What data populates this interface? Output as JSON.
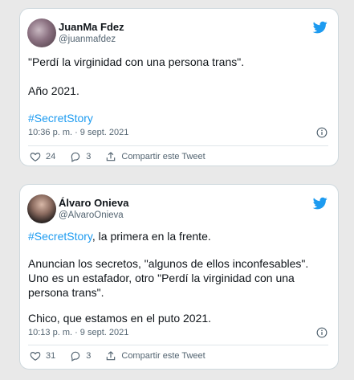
{
  "tweets": [
    {
      "author_name": "JuanMa Fdez",
      "author_handle": "@juanmafdez",
      "line1": "\"Perdí la virginidad con una persona trans\".",
      "line2": "Año 2021.",
      "hashtag": "#SecretStory",
      "timestamp": "10:36 p. m. · 9 sept. 2021",
      "likes": "24",
      "replies": "3",
      "share_label": "Compartir este Tweet"
    },
    {
      "author_name": "Álvaro Onieva",
      "author_handle": "@AlvaroOnieva",
      "hashtag": "#SecretStory",
      "line1_rest": ", la primera en la frente.",
      "para2_l1": "Anuncian los secretos, \"algunos de ellos inconfesables\".",
      "para2_l2": "Uno es un estafador, otro \"Perdí la virginidad con una",
      "para2_l3": "persona trans\".",
      "para3": "Chico, que estamos en el puto 2021.",
      "timestamp": "10:13 p. m. · 9 sept. 2021",
      "likes": "31",
      "replies": "3",
      "share_label": "Compartir este Tweet"
    }
  ],
  "colors": {
    "accent": "#1d9bf0",
    "text": "#0f1419",
    "muted": "#536471"
  },
  "icons": [
    "twitter-bird-icon",
    "info-icon",
    "heart-icon",
    "reply-icon",
    "share-icon"
  ]
}
